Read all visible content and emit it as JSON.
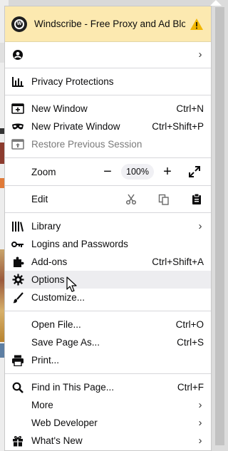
{
  "banner": {
    "title": "Windscribe - Free Proxy and Ad Blo..."
  },
  "account": {
    "label": ""
  },
  "privacy": {
    "label": "Privacy Protections"
  },
  "window_items": [
    {
      "label": "New Window",
      "shortcut": "Ctrl+N"
    },
    {
      "label": "New Private Window",
      "shortcut": "Ctrl+Shift+P"
    },
    {
      "label": "Restore Previous Session",
      "shortcut": ""
    }
  ],
  "zoom": {
    "label": "Zoom",
    "minus": "−",
    "value": "100%",
    "plus": "+"
  },
  "edit": {
    "label": "Edit"
  },
  "library_items": [
    {
      "label": "Library"
    },
    {
      "label": "Logins and Passwords"
    },
    {
      "label": "Add-ons",
      "shortcut": "Ctrl+Shift+A"
    },
    {
      "label": "Options"
    },
    {
      "label": "Customize..."
    }
  ],
  "file_items": [
    {
      "label": "Open File...",
      "shortcut": "Ctrl+O"
    },
    {
      "label": "Save Page As...",
      "shortcut": "Ctrl+S"
    },
    {
      "label": "Print..."
    }
  ],
  "tools_items": [
    {
      "label": "Find in This Page...",
      "shortcut": "Ctrl+F"
    },
    {
      "label": "More"
    },
    {
      "label": "Web Developer"
    },
    {
      "label": "What's New"
    }
  ],
  "colors": {
    "banner_bg": "#fce9b0",
    "warning": "#f2b600",
    "hover_bg": "#ededf0"
  }
}
